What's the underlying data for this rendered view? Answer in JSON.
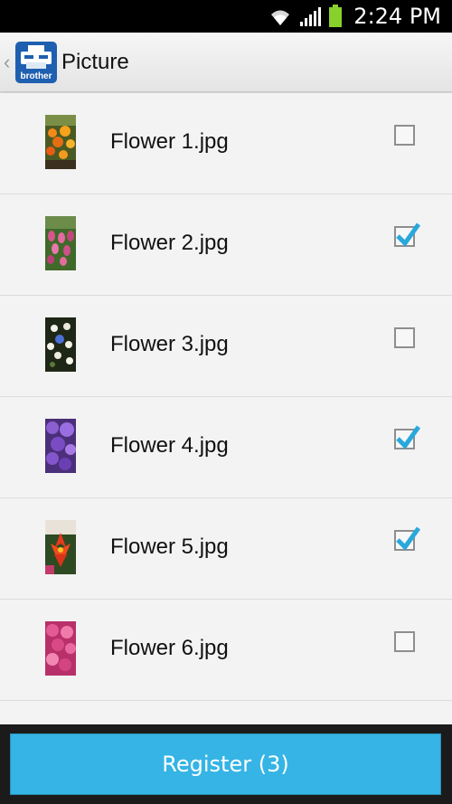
{
  "status_bar": {
    "time": "2:24 PM",
    "icons": [
      "wifi-icon",
      "signal-icon",
      "battery-icon"
    ]
  },
  "action_bar": {
    "back_icon": "chevron-left-icon",
    "logo_text": "brother",
    "title": "Picture"
  },
  "files": [
    {
      "name": "Flower 1.jpg",
      "checked": false
    },
    {
      "name": "Flower 2.jpg",
      "checked": true
    },
    {
      "name": "Flower 3.jpg",
      "checked": false
    },
    {
      "name": "Flower 4.jpg",
      "checked": true
    },
    {
      "name": "Flower 5.jpg",
      "checked": true
    },
    {
      "name": "Flower 6.jpg",
      "checked": false
    }
  ],
  "register_label": "Register (3)",
  "colors": {
    "accent": "#35b4e5",
    "check": "#29a8dc"
  }
}
